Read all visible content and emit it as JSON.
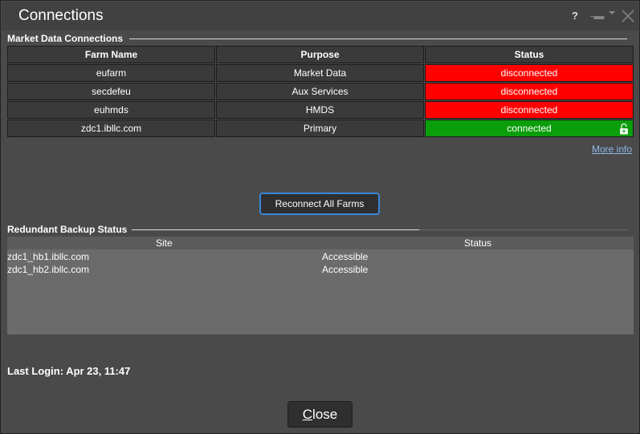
{
  "window": {
    "title": "Connections",
    "help_label": "?",
    "pin_label": "-▬"
  },
  "market_data": {
    "heading": "Market Data Connections",
    "columns": [
      "Farm Name",
      "Purpose",
      "Status"
    ],
    "rows": [
      {
        "farm": "eufarm",
        "purpose": "Market Data",
        "status": "disconnected"
      },
      {
        "farm": "secdefeu",
        "purpose": "Aux Services",
        "status": "disconnected"
      },
      {
        "farm": "euhmds",
        "purpose": "HMDS",
        "status": "disconnected"
      },
      {
        "farm": "zdc1.ibllc.com",
        "purpose": "Primary",
        "status": "connected"
      }
    ],
    "more_info": "More info",
    "reconnect_label": "Reconnect All Farms"
  },
  "backup": {
    "heading": "Redundant Backup Status",
    "columns": [
      "Site",
      "Status"
    ],
    "rows": [
      {
        "site": "zdc1_hb1.ibllc.com",
        "status": "Accessible"
      },
      {
        "site": "zdc1_hb2.ibllc.com",
        "status": "Accessible"
      }
    ]
  },
  "footer": {
    "last_login": "Last Login: Apr 23, 11:47",
    "close_label_first": "C",
    "close_label_rest": "lose"
  },
  "colors": {
    "disconnected": "#ff0000",
    "connected": "#0a9e0a",
    "accent": "#3a87d6",
    "link": "#8fb7e6"
  }
}
